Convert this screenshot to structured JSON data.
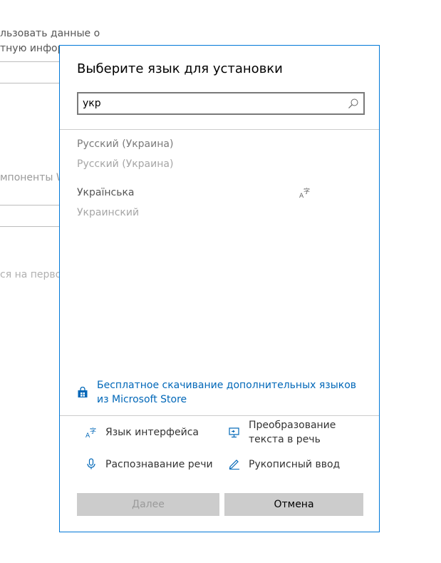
{
  "background": {
    "text_line1": "льзовать данные о",
    "text_line2": "тную информ",
    "text_line3": "мпоненты W",
    "text_line4": "ся на первом"
  },
  "dialog": {
    "title": "Выберите язык для установки",
    "search": {
      "value": "укр",
      "icon": "search-icon"
    },
    "results": [
      {
        "name": "Русский (Украина)",
        "native": "Русский (Украина)",
        "name_color": "#7a7a7a"
      },
      {
        "name": "Українська",
        "native": "Украинский",
        "name_color": "#555555",
        "feature_icon": "display-language-icon"
      }
    ],
    "store_link": {
      "text": "Бесплатное скачивание дополнительных языков из Microsoft Store",
      "icon": "store-icon"
    },
    "features": {
      "display_language": {
        "label": "Язык интерфейса",
        "icon": "display-language-icon"
      },
      "text_to_speech": {
        "label": "Преобразование текста в речь",
        "icon": "text-to-speech-icon"
      },
      "speech_recognition": {
        "label": "Распознавание речи",
        "icon": "microphone-icon"
      },
      "handwriting": {
        "label": "Рукописный ввод",
        "icon": "pen-icon"
      }
    },
    "buttons": {
      "next": "Далее",
      "cancel": "Отмена"
    },
    "colors": {
      "accent": "#0078d7",
      "link": "#0067b8",
      "button_bg": "#cccccc"
    }
  }
}
